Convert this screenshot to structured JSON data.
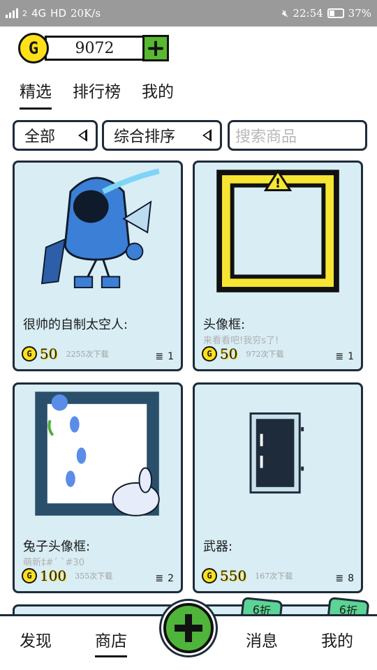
{
  "status_bar": {
    "signal": "2",
    "network": "4G",
    "hd": "HD",
    "speed": "20K/s",
    "time": "22:54",
    "battery": "37%"
  },
  "coins": {
    "icon": "G",
    "amount": "9072",
    "add": "+"
  },
  "tabs": [
    {
      "label": "精选",
      "active": true
    },
    {
      "label": "排行榜"
    },
    {
      "label": "我的"
    }
  ],
  "filters": {
    "category": "全部",
    "sort": "综合排序",
    "search_placeholder": "搜索商品"
  },
  "cards": [
    {
      "title": "很帅的自制太空人:",
      "desc": "",
      "price": "50",
      "downloads": "2255次下载",
      "count": "1",
      "thumb": "astronaut-icon"
    },
    {
      "title": "头像框:",
      "desc": "来看看吧!我穷s了!",
      "price": "50",
      "downloads": "972次下载",
      "count": "1",
      "thumb": "warning-frame-icon"
    },
    {
      "title": "兔子头像框:",
      "desc": "萌新‡#´ `#30",
      "price": "100",
      "downloads": "355次下载",
      "count": "2",
      "thumb": "rabbit-frame-icon"
    },
    {
      "title": "武器:",
      "desc": "",
      "price": "550",
      "downloads": "167次下载",
      "count": "8",
      "thumb": "weapon-box-icon"
    }
  ],
  "peek_badges": [
    "6折",
    "6折"
  ],
  "bottom_nav": [
    {
      "label": "发现"
    },
    {
      "label": "商店",
      "active": true
    },
    {
      "label": "消息"
    },
    {
      "label": "我的"
    }
  ],
  "colors": {
    "card_bg": "#d8edf4",
    "outline": "#1d2b3a",
    "coin": "#ffe11a",
    "add_green": "#58b830",
    "badge_green": "#5bd496"
  }
}
